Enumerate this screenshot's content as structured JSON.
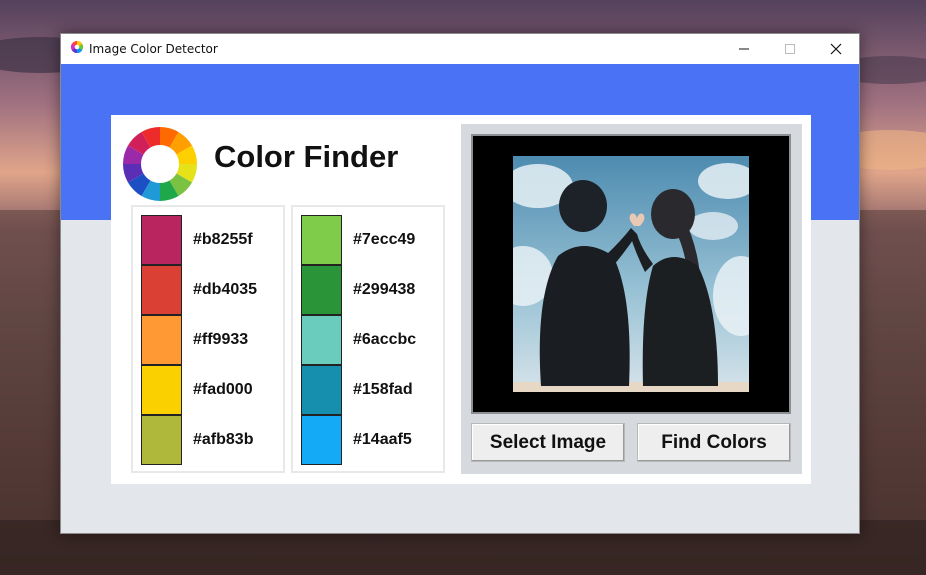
{
  "window": {
    "title": "Image Color Detector"
  },
  "app": {
    "heading": "Color Finder"
  },
  "palette": {
    "left": [
      {
        "hex": "#b8255f"
      },
      {
        "hex": "#db4035"
      },
      {
        "hex": "#ff9933"
      },
      {
        "hex": "#fad000"
      },
      {
        "hex": "#afb83b"
      }
    ],
    "right": [
      {
        "hex": "#7ecc49"
      },
      {
        "hex": "#299438"
      },
      {
        "hex": "#6accbc"
      },
      {
        "hex": "#158fad"
      },
      {
        "hex": "#14aaf5"
      }
    ]
  },
  "buttons": {
    "select_image": "Select Image",
    "find_colors": "Find Colors"
  },
  "colors": {
    "header_band": "#4a72f5",
    "window_bg": "#e3e6ea",
    "image_area_bg": "#d6d9de"
  },
  "icons": {
    "app_icon": "color-wheel-icon",
    "logo": "color-wheel-logo",
    "minimize": "minimize-icon",
    "maximize": "maximize-icon",
    "close": "close-icon"
  }
}
